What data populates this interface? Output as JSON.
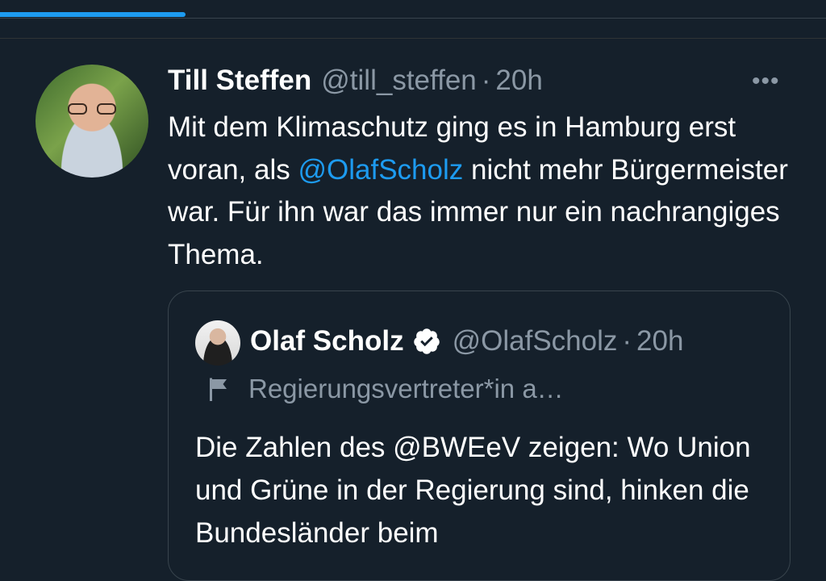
{
  "tweet": {
    "author_name": "Till Steffen",
    "author_handle": "@till_steffen",
    "separator": "·",
    "time": "20h",
    "more_label": "•••",
    "text_part1": "Mit dem Klimaschutz ging es in Hamburg erst voran, als ",
    "mention": "@OlafScholz",
    "text_part2": " nicht mehr Bürgermeister war. Für ihn war das immer nur ein nachrangiges Thema."
  },
  "quoted_tweet": {
    "author_name": "Olaf Scholz",
    "author_handle": "@OlafScholz",
    "separator": "·",
    "time": "20h",
    "label": "Regierungsvertreter*in a…",
    "text": "Die Zahlen des @BWEeV zeigen: Wo Union und Grüne in der Regierung sind, hinken die Bundesländer beim"
  },
  "icons": {
    "verified": "verified-badge-icon",
    "flag": "flag-icon",
    "more": "more-horizontal-icon"
  },
  "colors": {
    "background": "#15202b",
    "accent": "#1d9bf0",
    "secondary_text": "#8b98a5"
  },
  "progress_fraction": 0.225
}
